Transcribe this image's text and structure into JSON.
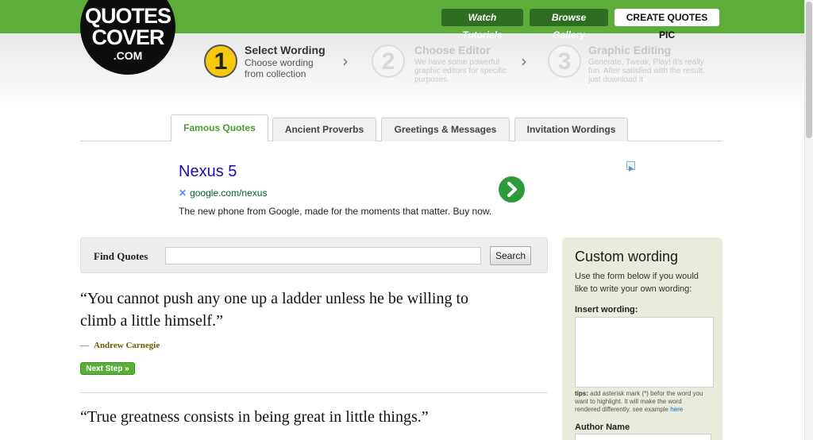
{
  "top_nav": {
    "watch_tutorials": "Watch Tutorials",
    "browse_gallery": "Browse Gallery",
    "create_quotes_pic": "CREATE QUOTES PIC"
  },
  "logo": {
    "line1": "QUOTES",
    "line2": "COVER",
    "line3": ".COM"
  },
  "steps": [
    {
      "number": "1",
      "title": "Select Wording",
      "desc_line1": "Choose wording",
      "desc_line2": "from collection",
      "active": true
    },
    {
      "number": "2",
      "title": "Choose Editor",
      "desc_line1": "We have some powerful",
      "desc_line2": "graphic editors for specific",
      "desc_line3": "purposes.",
      "active": false
    },
    {
      "number": "3",
      "title": "Graphic Editing",
      "desc_line1": "Generate, Tweak, Play!  It's really",
      "desc_line2": "fun. After satisfied with the result,",
      "desc_line3": "just download it",
      "active": false
    }
  ],
  "chevron": "›",
  "tabs": [
    {
      "label": "Famous Quotes",
      "active": true
    },
    {
      "label": "Ancient Proverbs",
      "active": false
    },
    {
      "label": "Greetings & Messages",
      "active": false
    },
    {
      "label": "Invitation Wordings",
      "active": false
    }
  ],
  "ad": {
    "title": "Nexus 5",
    "url": "google.com/nexus",
    "description": "The new phone from Google, made for the moments that matter. Buy now."
  },
  "search": {
    "label": "Find Quotes",
    "value": "",
    "button": "Search"
  },
  "quotes": [
    {
      "line1": "“You cannot push any one up a ladder unless he be willing to",
      "line2": "climb a little himself.”",
      "author": "Andrew Carnegie",
      "dash": "—"
    },
    {
      "line1": "“True greatness consists in being great in little things.”"
    }
  ],
  "next_step": "Next Step »",
  "custom_wording": {
    "title": "Custom wording",
    "desc_line1": "Use the form below if you would",
    "desc_line2": "like to write your own wording:",
    "insert_label": "Insert wording:",
    "tips_bold": "tips:",
    "tips_line1": " add asterisk mark (*) befor the word you",
    "tips_line2": "want to highlight. It will make the word",
    "tips_line3": "rendered differently. see example ",
    "tips_link": "here",
    "author_label": "Author Name"
  },
  "colors": {
    "brand_green": "#5cad3a",
    "dark_green_button": "#2f6e22",
    "step_active_yellow": "#f6c90e",
    "ad_link_blue": "#1a0dab",
    "author_olive": "#6b5a00"
  }
}
